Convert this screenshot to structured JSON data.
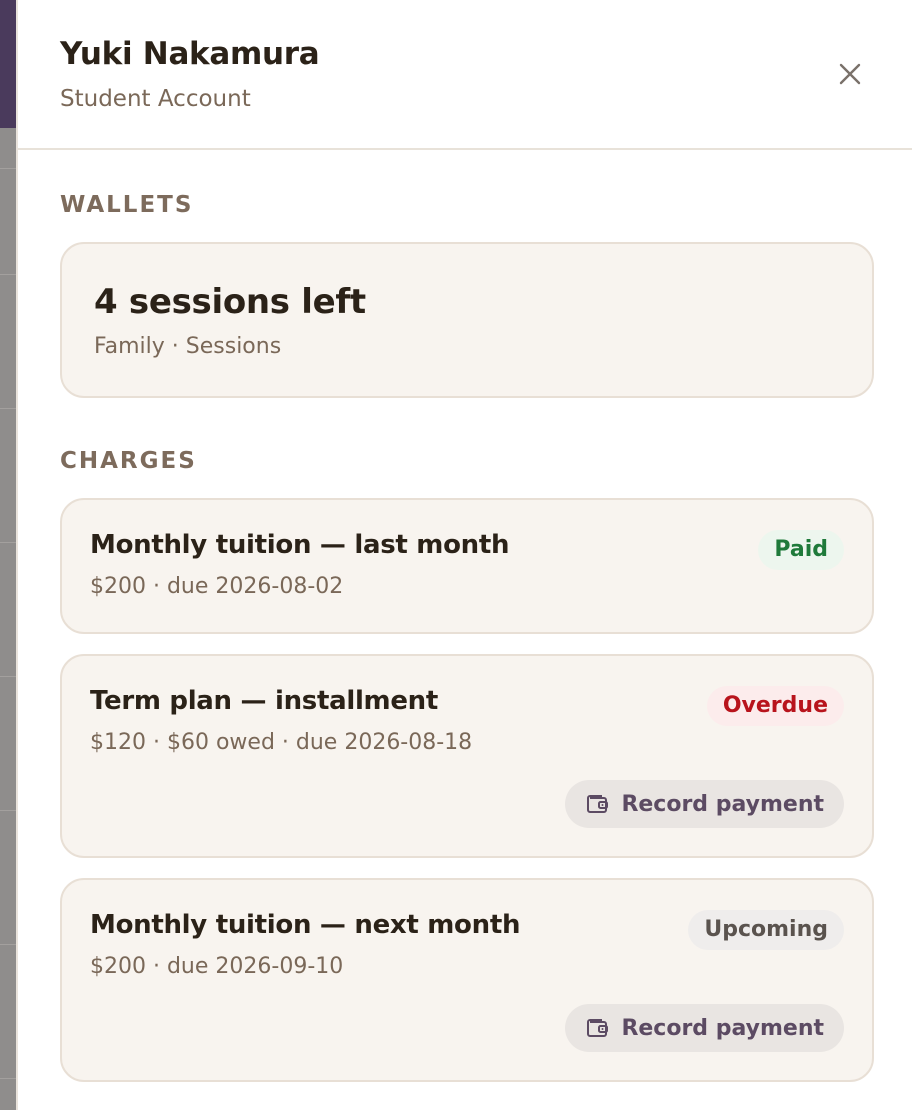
{
  "header": {
    "name": "Yuki Nakamura",
    "subtitle": "Student Account",
    "close_icon": "close-icon"
  },
  "wallets": {
    "section_label": "WALLETS",
    "items": [
      {
        "title": "4 sessions left",
        "meta": "Family · Sessions"
      }
    ]
  },
  "charges": {
    "section_label": "CHARGES",
    "items": [
      {
        "title": "Monthly tuition — last month",
        "meta": "$200 · due 2026-08-02",
        "status": "Paid",
        "status_color": "#1f7a3a"
      },
      {
        "title": "Term plan — installment",
        "meta": "$120 · $60 owed · due 2026-08-18",
        "status": "Overdue",
        "status_color": "#b8141c",
        "action_label": "Record payment",
        "action_icon": "wallet-icon"
      },
      {
        "title": "Monthly tuition — next month",
        "meta": "$200 · due 2026-09-10",
        "status": "Upcoming",
        "status_color": "#5a534e",
        "action_label": "Record payment",
        "action_icon": "wallet-icon"
      }
    ]
  },
  "colors": {
    "accent": "#4a3a5c",
    "card_background": "#f8f4ef",
    "text_primary": "#2b2218",
    "text_muted": "#7a6858"
  }
}
